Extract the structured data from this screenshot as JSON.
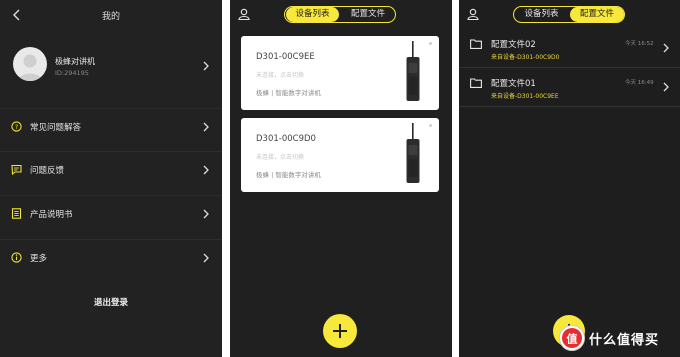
{
  "mine": {
    "title": "我的",
    "profile_name": "极蜂对讲机",
    "profile_id": "ID:294195",
    "menu": [
      {
        "label": "常见问题解答"
      },
      {
        "label": "问题反馈"
      },
      {
        "label": "产品说明书"
      },
      {
        "label": "更多"
      }
    ],
    "logout": "退出登录"
  },
  "devices": {
    "tabs": [
      "设备列表",
      "配置文件"
    ],
    "active_tab": 0,
    "cards": [
      {
        "name": "D301-00C9EE",
        "status": "未连接，点击切换",
        "desc": "极蜂 | 智能数字对讲机"
      },
      {
        "name": "D301-00C9D0",
        "status": "未连接，点击切换",
        "desc": "极蜂 | 智能数字对讲机"
      }
    ],
    "add_button": "add-icon"
  },
  "configs": {
    "tabs": [
      "设备列表",
      "配置文件"
    ],
    "active_tab": 1,
    "files": [
      {
        "name": "配置文件02",
        "source": "来自设备-D301-00C9D0",
        "time": "今天 16:52"
      },
      {
        "name": "配置文件01",
        "source": "来自设备-D301-00C9EE",
        "time": "今天 16:49"
      }
    ]
  },
  "watermark": {
    "text": "什么值得买",
    "symbol": "值"
  },
  "colors": {
    "accent": "#f7e83b",
    "background": "#222222",
    "card": "#ffffff"
  }
}
